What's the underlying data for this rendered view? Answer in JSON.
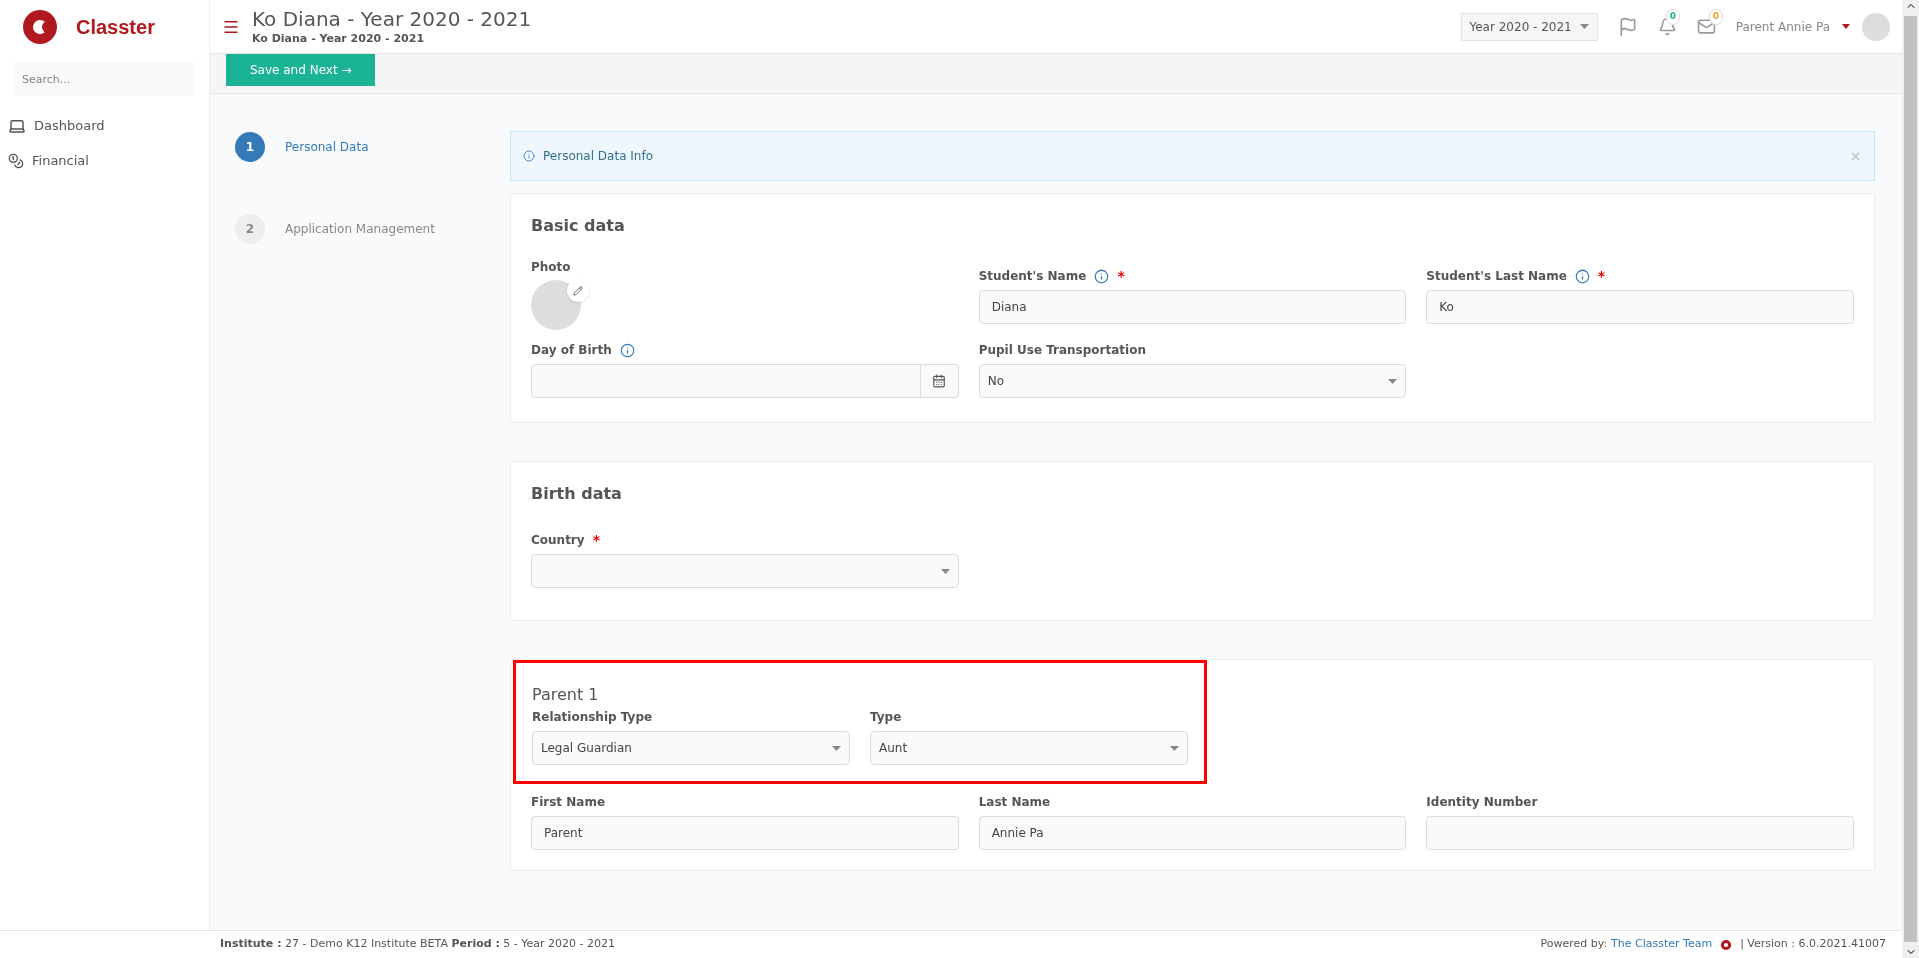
{
  "brand": {
    "name": "Classter"
  },
  "sidebar": {
    "search": {
      "placeholder": "Search..."
    },
    "items": [
      {
        "label": "Dashboard",
        "kind": "laptop"
      },
      {
        "label": "Financial",
        "kind": "coins"
      }
    ]
  },
  "header": {
    "title": "Ko Diana - Year 2020 - 2021",
    "subtitle": "Ko Diana - Year 2020 - 2021",
    "year_select": "Year 2020 - 2021",
    "notifications": "0",
    "messages": "0",
    "user": "Parent Annie Pa"
  },
  "toolbar": {
    "save_button": "Save and Next →"
  },
  "steps": [
    {
      "number": "1",
      "label": "Personal Data",
      "selected": true
    },
    {
      "number": "2",
      "label": "Application Management",
      "selected": false
    }
  ],
  "info_alert": {
    "text": "Personal Data Info"
  },
  "basic_data": {
    "title": "Basic data",
    "photo_label": "Photo",
    "fields": [
      {
        "label": "Student's Name",
        "kind": "text",
        "value": "Diana",
        "info": true,
        "required_mark": "*"
      },
      {
        "label": "Student's Last Name",
        "kind": "text",
        "value": "Ko",
        "info": true,
        "required_mark": "*"
      },
      {
        "label": "Day of Birth",
        "kind": "date",
        "info": true
      },
      {
        "label": "Pupil Use Transportation",
        "kind": "select",
        "value": "No",
        "info": false
      }
    ]
  },
  "birth_data": {
    "title": "Birth data",
    "fields": [
      {
        "label": "Country",
        "kind": "select",
        "info": false,
        "required_mark": "*"
      }
    ]
  },
  "parent": {
    "title": "Parent 1",
    "highlighted": true,
    "type_fields": [
      {
        "label": "Relationship Type",
        "kind": "select",
        "value": "Legal Guardian",
        "info": false
      },
      {
        "label": "Type",
        "kind": "select",
        "value": "Aunt",
        "info": false
      }
    ],
    "fields": [
      {
        "label": "First Name",
        "kind": "text",
        "value": "Parent",
        "info": false
      },
      {
        "label": "Last Name",
        "kind": "text",
        "value": "Annie Pa",
        "info": false
      },
      {
        "label": "Identity Number",
        "kind": "text",
        "info": false
      }
    ]
  },
  "status_bar": {
    "institute_label": "Institute :",
    "institute": "27 - Demo K12 Institute BETA",
    "period_label": "Period :",
    "period": "5 - Year 2020 - 2021",
    "powered": "Powered by:",
    "team_link": "The Classter Team",
    "version": "| Version : 6.0.2021.41007"
  }
}
